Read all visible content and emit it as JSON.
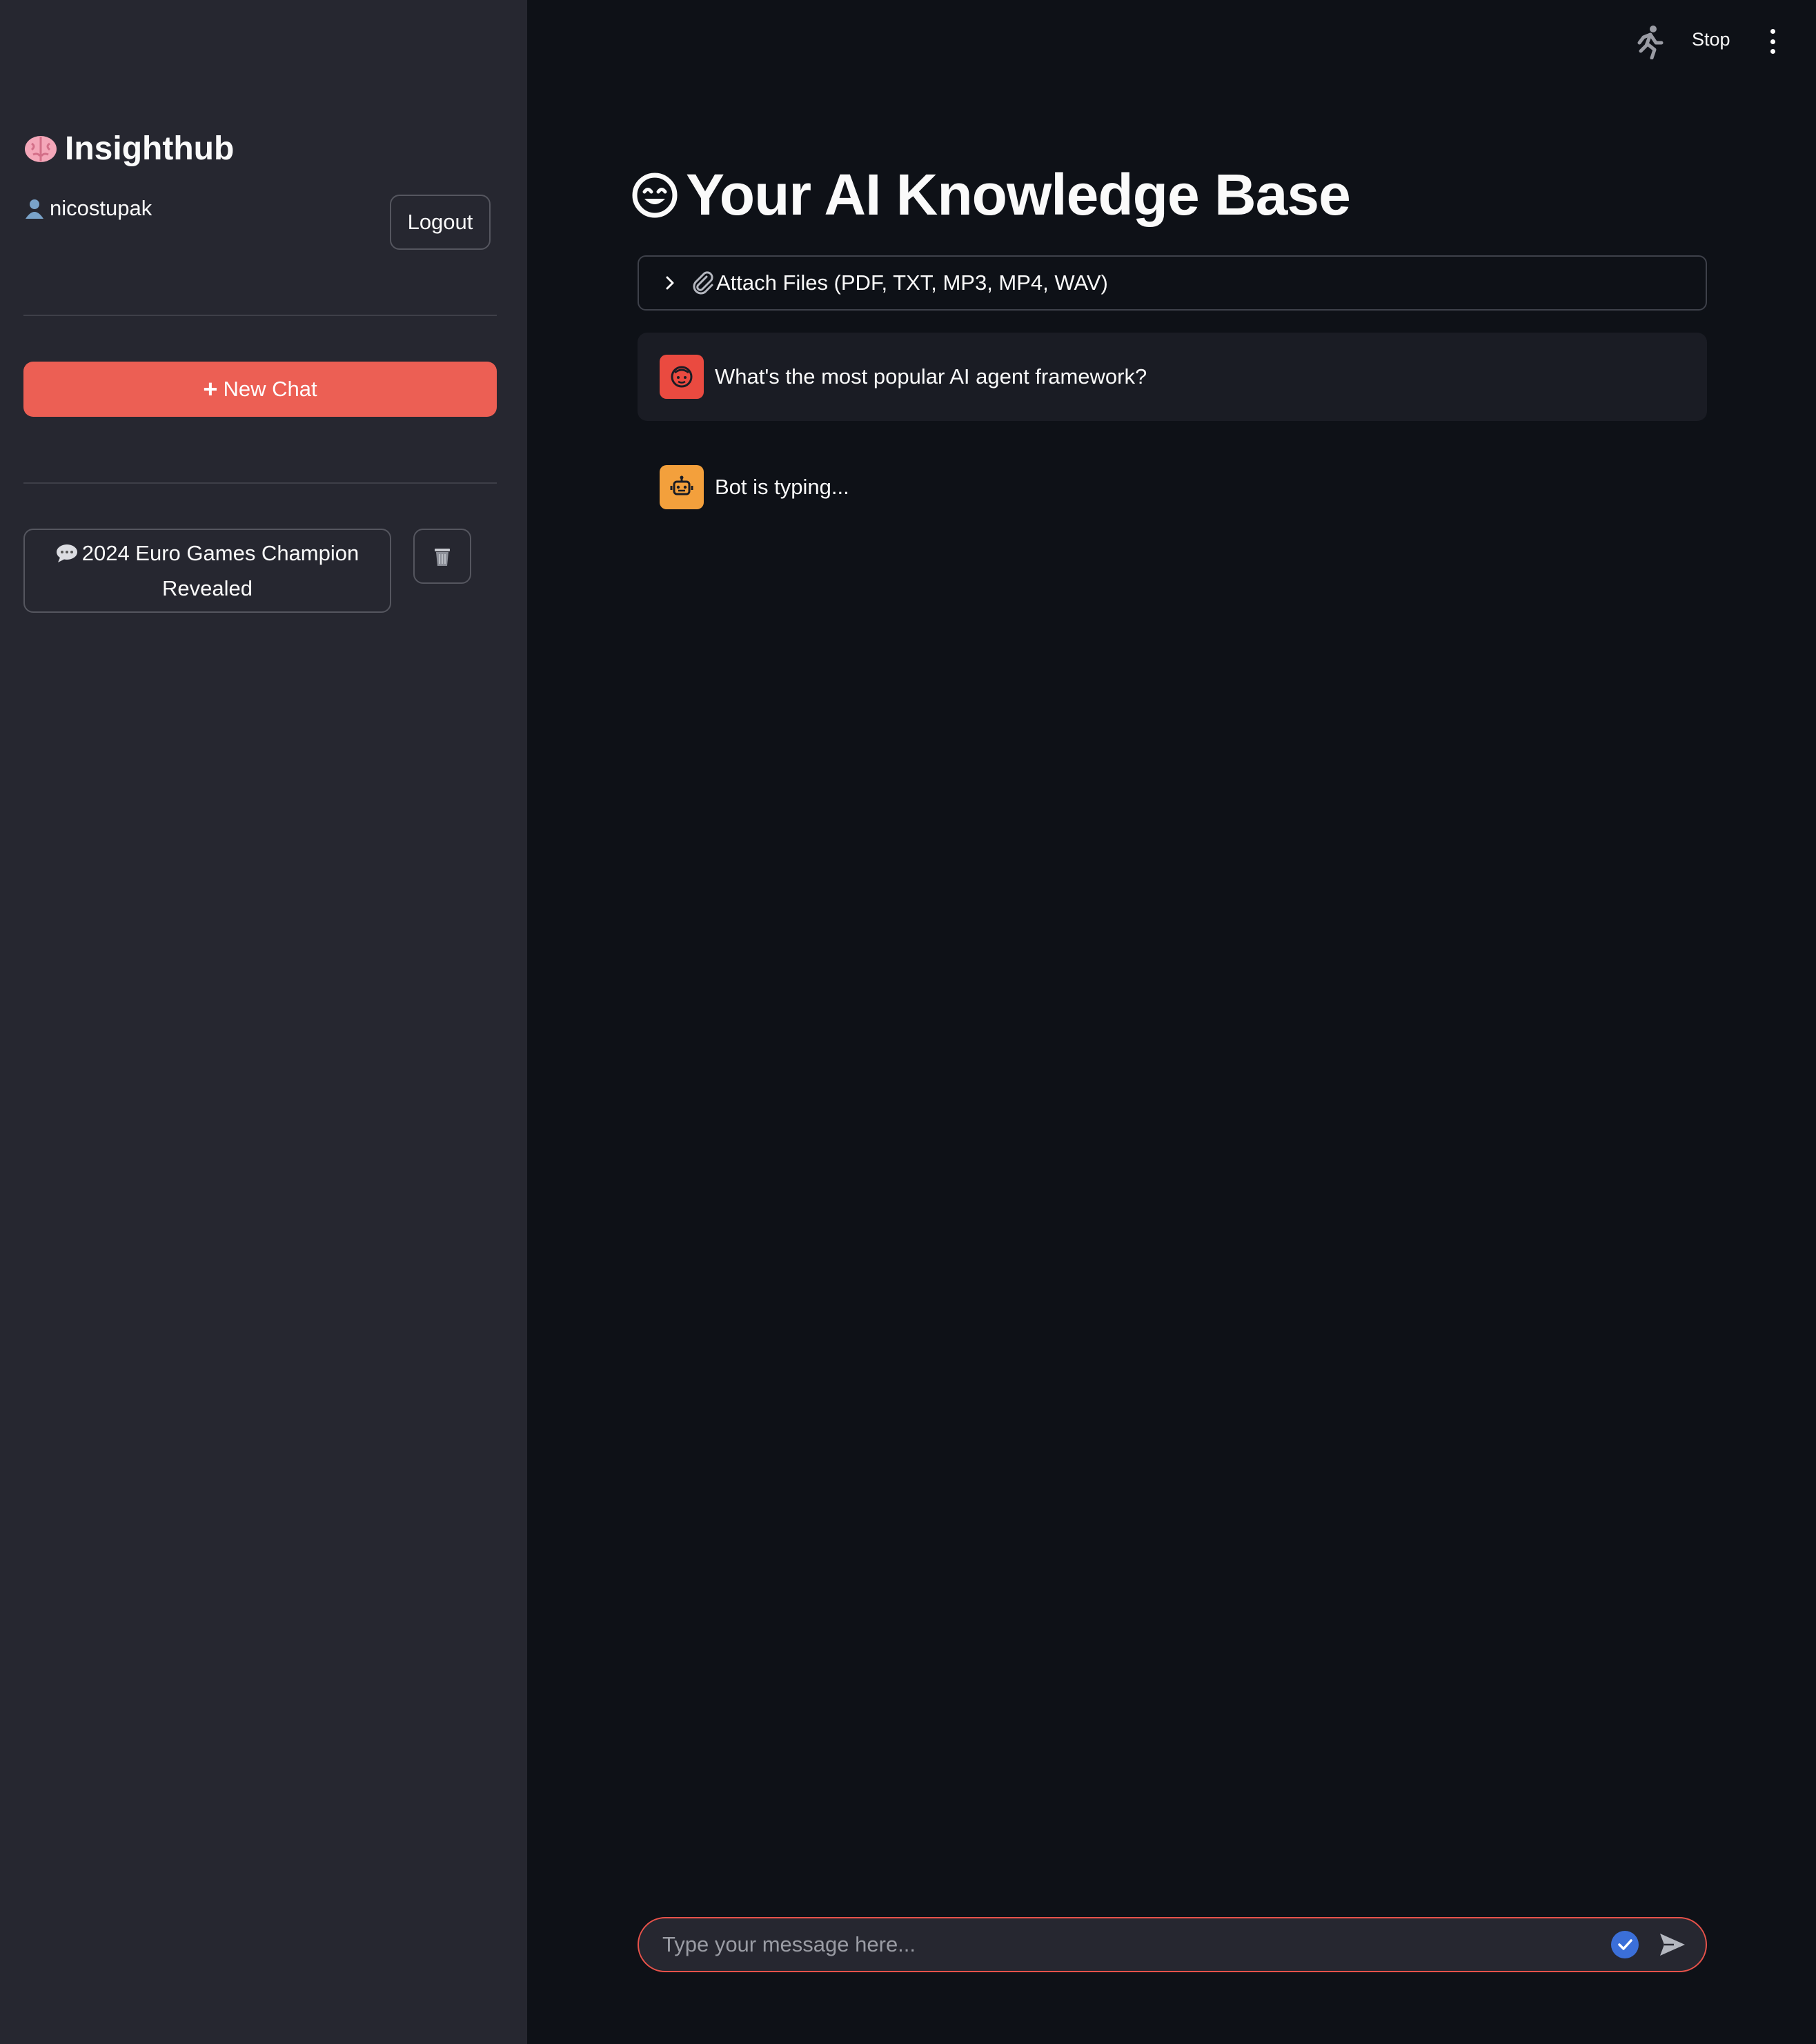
{
  "sidebar": {
    "brand_title": "Insighthub",
    "username": "nicostupak",
    "logout_label": "Logout",
    "new_chat_label": "New Chat",
    "chats": [
      {
        "title_line1": "2024 Euro Games Champion",
        "title_line2": "Revealed"
      }
    ]
  },
  "topbar": {
    "stop_label": "Stop"
  },
  "main": {
    "title": "Your AI Knowledge Base",
    "attach_label": "Attach Files (PDF, TXT, MP3, MP4, WAV)",
    "messages": [
      {
        "role": "user",
        "text": "What's the most popular AI agent framework?"
      },
      {
        "role": "assistant",
        "text": "Bot is typing..."
      }
    ],
    "input_placeholder": "Type your message here..."
  },
  "colors": {
    "sidebar_bg": "#262730",
    "main_bg": "#0e1117",
    "accent": "#ec5f54",
    "user_avatar": "#ea4a40",
    "bot_avatar": "#f3a03c"
  }
}
